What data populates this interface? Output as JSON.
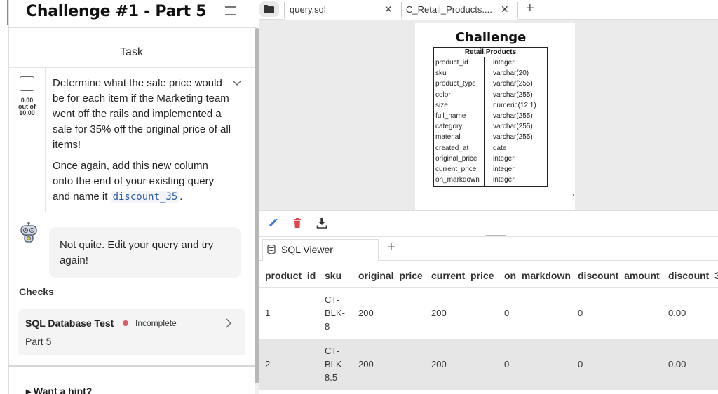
{
  "challenge": {
    "title": "Challenge #1 - Part 5",
    "task_heading": "Task",
    "score_top": "0.00",
    "score_mid": "out of",
    "score_bottom": "10.00",
    "task_p1": "Determine what the sale price would be for each item if the Marketing team went off the rails and implemented a sale for 35% off the original price of all items!",
    "task_p2_before": "Once again, add this new column onto the end of your existing query and name it ",
    "task_p2_code": "discount_35",
    "task_p2_after": ".",
    "feedback": "Not quite. Edit your query and try again!",
    "checks_label": "Checks",
    "check_name": "SQL Database Test",
    "check_status": "Incomplete",
    "check_sub": "Part 5",
    "hint": "▸ Want a hint?"
  },
  "tabs": [
    {
      "label": "query.sql"
    },
    {
      "label": "C_Retail_Products...."
    }
  ],
  "diagram": {
    "title": "Challenge",
    "table_name": "Retail.Products",
    "columns": [
      {
        "name": "product_id",
        "type": "integer"
      },
      {
        "name": "sku",
        "type": "varchar(20)"
      },
      {
        "name": "product_type",
        "type": "varchar(255)"
      },
      {
        "name": "color",
        "type": "varchar(255)"
      },
      {
        "name": "size",
        "type": "numeric(12,1)"
      },
      {
        "name": "full_name",
        "type": "varchar(255)"
      },
      {
        "name": "category",
        "type": "varchar(255)"
      },
      {
        "name": "material",
        "type": "varchar(255)"
      },
      {
        "name": "created_at",
        "type": "date"
      },
      {
        "name": "original_price",
        "type": "integer"
      },
      {
        "name": "current_price",
        "type": "integer"
      },
      {
        "name": "on_markdown",
        "type": "integer"
      }
    ]
  },
  "viewer": {
    "tab_label": "SQL Viewer",
    "headers": [
      "product_id",
      "sku",
      "original_price",
      "current_price",
      "on_markdown",
      "discount_amount",
      "discount_3"
    ],
    "rows": [
      {
        "product_id": "1",
        "sku_lines": [
          "CT-",
          "BLK-",
          "8"
        ],
        "original_price": "200",
        "current_price": "200",
        "on_markdown": "0",
        "discount_amount": "0",
        "discount_3": "0.00"
      },
      {
        "product_id": "2",
        "sku_lines": [
          "CT-",
          "BLK-",
          "8.5"
        ],
        "original_price": "200",
        "current_price": "200",
        "on_markdown": "0",
        "discount_amount": "0",
        "discount_3": "0.00"
      }
    ]
  },
  "colors": {
    "accent": "#5b8def",
    "status_incomplete": "#e05c6a",
    "edit_icon": "#3a7bd5",
    "delete_icon": "#e0474c",
    "code_text": "#2e5da8"
  }
}
